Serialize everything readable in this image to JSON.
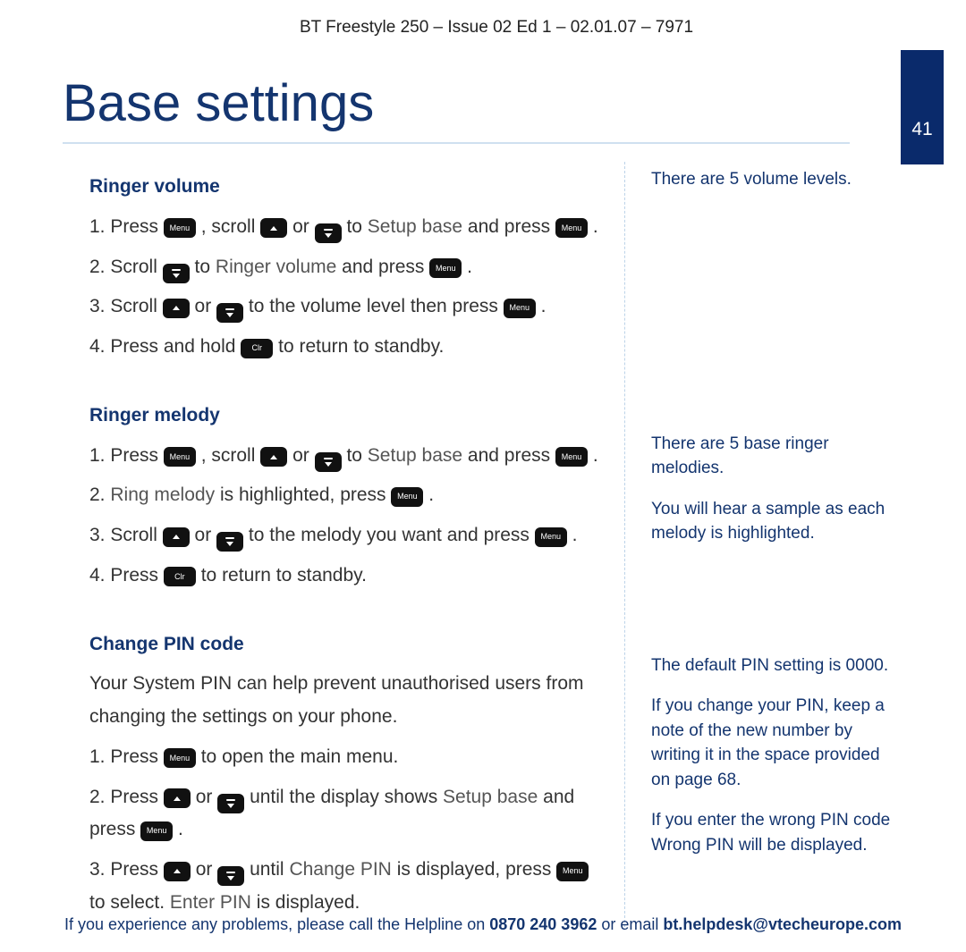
{
  "doc_header": "BT Freestyle 250 – Issue 02 Ed 1 – 02.01.07 – 7971",
  "page_number": "41",
  "page_title": "Base settings",
  "buttons": {
    "menu": "Menu",
    "clr": "Clr"
  },
  "main": {
    "ringer_volume": {
      "heading": "Ringer volume",
      "s1a": "1. Press ",
      "s1b": ", scroll ",
      "s1c": " or ",
      "s1d": " to ",
      "s1menu": "Setup base",
      "s1e": " and press ",
      "s1f": ".",
      "s2a": "2. Scroll ",
      "s2b": " to ",
      "s2menu": "Ringer volume",
      "s2c": " and press ",
      "s2d": ".",
      "s3a": "3. Scroll",
      "s3b": " or ",
      "s3c": " to the volume level then press ",
      "s3d": ".",
      "s4a": "4. Press and hold ",
      "s4b": " to return to standby."
    },
    "ringer_melody": {
      "heading": "Ringer melody",
      "s1a": "1. Press ",
      "s1b": ", scroll ",
      "s1c": " or ",
      "s1d": " to ",
      "s1menu": "Setup base",
      "s1e": " and press ",
      "s1f": ".",
      "s2a": "2. ",
      "s2menu": "Ring melody",
      "s2b": " is highlighted, press ",
      "s2c": ".",
      "s3a": "3. Scroll ",
      "s3b": " or ",
      "s3c": " to the melody you want and press ",
      "s3d": ".",
      "s4a": "4. Press ",
      "s4b": " to return to standby."
    },
    "change_pin": {
      "heading": "Change PIN code",
      "intro": "Your System PIN can help prevent unauthorised users from changing the settings on your phone.",
      "s1a": "1. Press ",
      "s1b": " to open the main menu.",
      "s2a": "2. Press ",
      "s2b": " or ",
      "s2c": " until the display shows ",
      "s2menu": "Setup base",
      "s2d": " and press ",
      "s2e": ".",
      "s3a": "3. Press ",
      "s3b": " or ",
      "s3c": " until ",
      "s3menu1": "Change PIN",
      "s3d": " is displayed, press ",
      "s3e": " to select. ",
      "s3menu2": "Enter PIN",
      "s3f": " is displayed."
    }
  },
  "side": {
    "volume_levels": "There are 5 volume levels.",
    "melodies1": "There are 5 base ringer melodies.",
    "melodies2": "You will hear a sample as each melody is highlighted.",
    "pin1": "The default PIN setting is 0000.",
    "pin2": "If you change your PIN, keep a note of the new number by writing it in the space provided on page 68.",
    "pin3": "If you enter the wrong PIN code Wrong PIN will be displayed."
  },
  "footer": {
    "a": "If you experience any problems, please call the Helpline on ",
    "phone": "0870 240 3962",
    "b": " or email ",
    "email": "bt.helpdesk@vtecheurope.com"
  }
}
